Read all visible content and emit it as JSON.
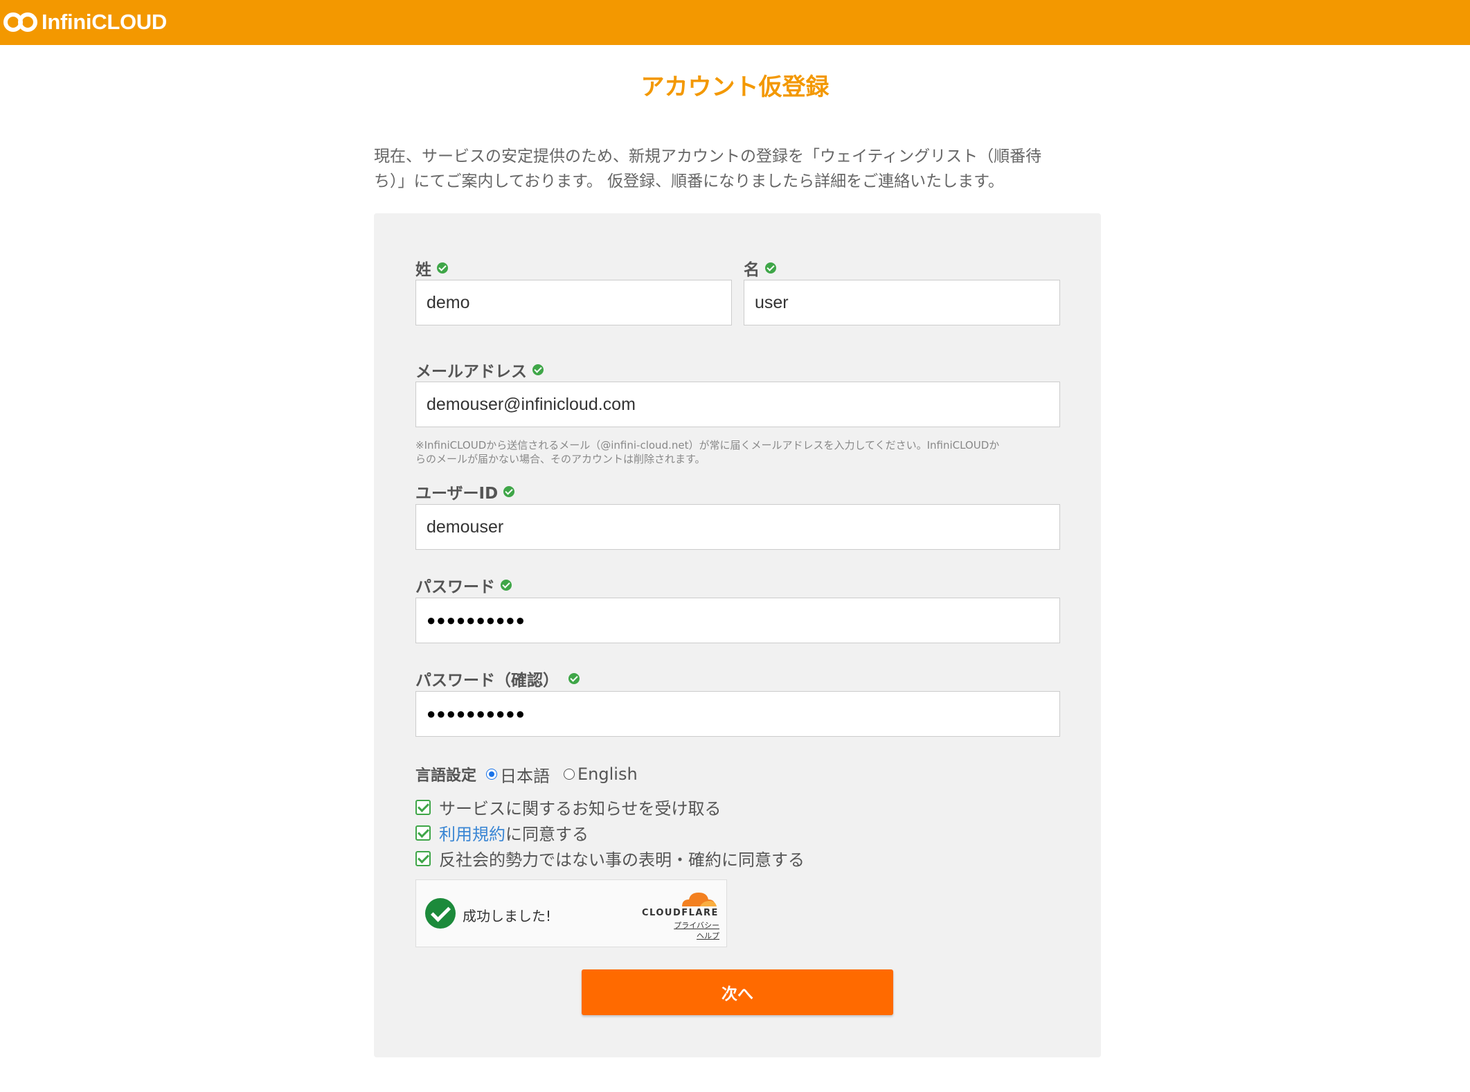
{
  "header": {
    "brand": "InfiniCLOUD",
    "bar_color": "#f39800"
  },
  "page": {
    "title": "アカウント仮登録",
    "intro_line1": "現在、サービスの安定提供のため、新規アカウントの登録を「ウェイティングリスト（順番待",
    "intro_line2": "ち）」にてご案内しております。 仮登録、順番になりましたら詳細をご連絡いたします。"
  },
  "form": {
    "last_name": {
      "label": "姓",
      "value": "demo"
    },
    "first_name": {
      "label": "名",
      "value": "user"
    },
    "email": {
      "label": "メールアドレス",
      "value": "demouser@infinicloud.com",
      "note_line1": "※InfiniCLOUDから送信されるメール（@infini-cloud.net）が常に届くメールアドレスを入力してください。InfiniCLOUDか",
      "note_line2": "らのメールが届かない場合、そのアカウントは削除されます。"
    },
    "user_id": {
      "label": "ユーザーID",
      "value": "demouser"
    },
    "password": {
      "label": "パスワード",
      "masked_value": "●●●●●●●●●●"
    },
    "password_confirm": {
      "label": "パスワード（確認）",
      "masked_value": "●●●●●●●●●●"
    },
    "language": {
      "label": "言語設定",
      "options": [
        "日本語",
        "English"
      ],
      "selected": "日本語"
    },
    "checkboxes": {
      "newsletter": "サービスに関するお知らせを受け取る",
      "terms_link": "利用規約",
      "terms_suffix": "に同意する",
      "anti_social": "反社会的勢力ではない事の表明・確約に同意する"
    },
    "captcha": {
      "status": "成功しました!",
      "brand": "CLOUDFLARE",
      "privacy": "プライバシー",
      "help": "ヘルプ"
    },
    "submit_label": "次へ",
    "accent_color": "#ff6a00",
    "valid_color": "#3fa648"
  }
}
